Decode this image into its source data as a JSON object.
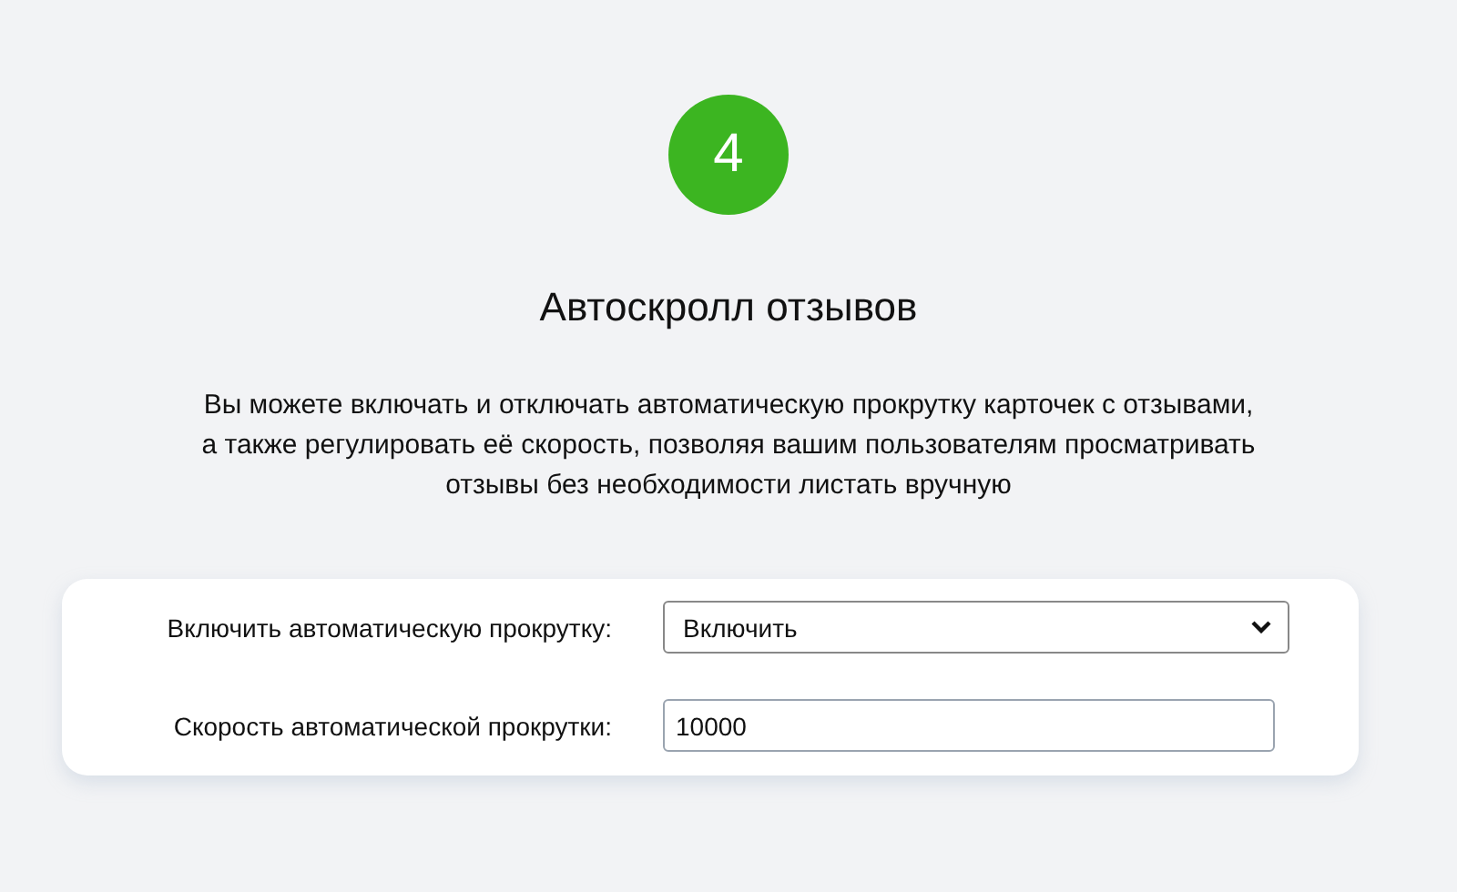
{
  "step": {
    "number": "4"
  },
  "title": "Автоскролл отзывов",
  "description": "Вы можете включать и отключать автоматическую прокрутку карточек с отзывами, а также регулировать её скорость, позволяя вашим пользователям просматривать отзывы без необходимости листать вручную",
  "settings": [
    {
      "kind": "select",
      "label": "Включить автоматическую прокрутку:",
      "value": "Включить"
    },
    {
      "kind": "input",
      "label": "Скорость автоматической прокрутки:",
      "value": "10000"
    }
  ]
}
